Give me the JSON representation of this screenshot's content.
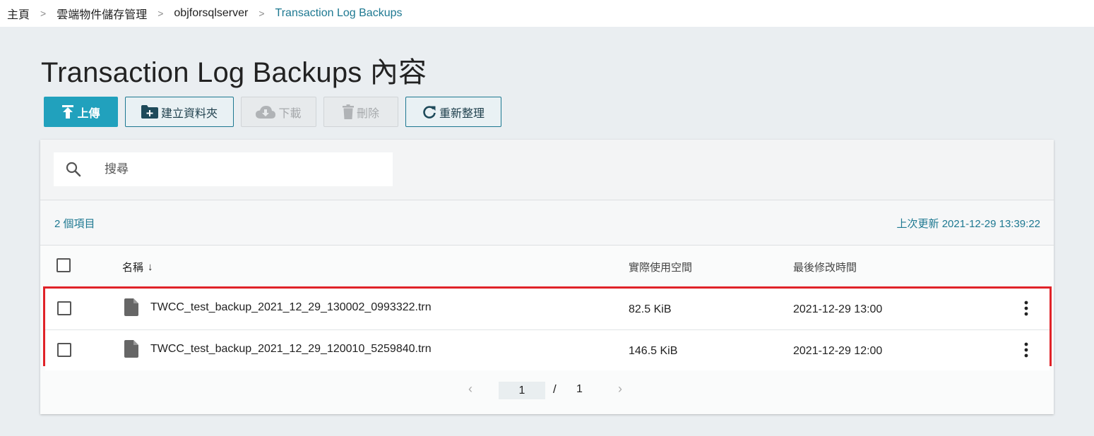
{
  "breadcrumb": {
    "items": [
      "主頁",
      "雲端物件儲存管理",
      "objforsqlserver",
      "Transaction Log Backups"
    ],
    "separator": ">"
  },
  "page_title": "Transaction Log Backups 內容",
  "toolbar": {
    "upload": "上傳",
    "create_folder": "建立資料夾",
    "download": "下載",
    "delete": "刪除",
    "refresh": "重新整理"
  },
  "search": {
    "placeholder": "搜尋"
  },
  "summary": {
    "count": "2 個項目",
    "updated": "上次更新 2021-12-29 13:39:22"
  },
  "table": {
    "columns": {
      "name": "名稱",
      "size": "實際使用空間",
      "modified": "最後修改時間"
    },
    "sort_indicator": "↓",
    "rows": [
      {
        "name": "TWCC_test_backup_2021_12_29_130002_0993322.trn",
        "size": "82.5 KiB",
        "modified": "2021-12-29 13:00"
      },
      {
        "name": "TWCC_test_backup_2021_12_29_120010_5259840.trn",
        "size": "146.5 KiB",
        "modified": "2021-12-29 12:00"
      }
    ]
  },
  "pagination": {
    "current": "1",
    "separator": "/",
    "total": "1",
    "prev": "‹",
    "next": "›"
  },
  "colors": {
    "accent": "#21a1bd",
    "link": "#1d7891",
    "highlight_border": "#e02228"
  }
}
